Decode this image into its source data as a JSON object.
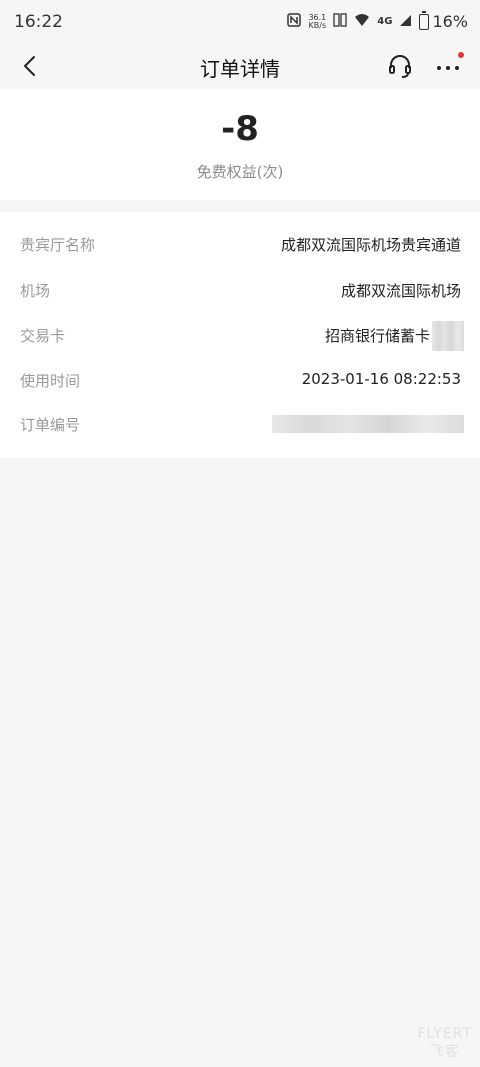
{
  "status_bar": {
    "time": "16:22",
    "net_speed_value": "36.1",
    "net_speed_unit": "KB/s",
    "network": "4G",
    "battery": "16%"
  },
  "nav": {
    "title": "订单详情",
    "back_icon": "chevron-left-icon",
    "support_icon": "headset-icon",
    "more_icon": "more-dots-icon",
    "badge_color": "#e5322d"
  },
  "summary": {
    "amount": "-8",
    "label": "免费权益(次)"
  },
  "details": [
    {
      "label": "贵宾厅名称",
      "value": "成都双流国际机场贵宾通道"
    },
    {
      "label": "机场",
      "value": "成都双流国际机场"
    },
    {
      "label": "交易卡",
      "value": "招商银行储蓄卡"
    },
    {
      "label": "使用时间",
      "value": "2023-01-16 08:22:53"
    },
    {
      "label": "订单编号",
      "value": ""
    }
  ],
  "watermark": {
    "line1": "FLYERT",
    "line2": "飞客"
  }
}
